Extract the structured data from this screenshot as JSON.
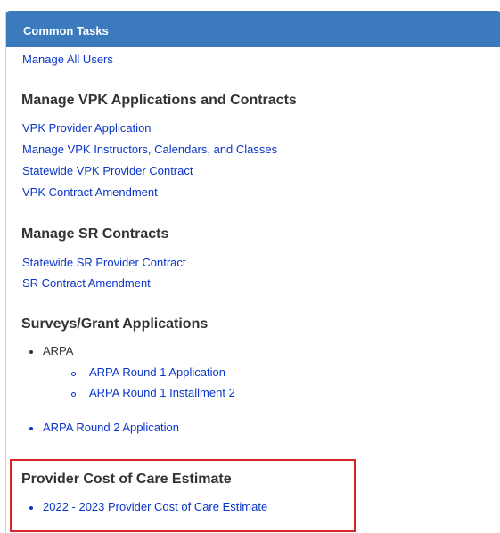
{
  "panel": {
    "title": "Common Tasks"
  },
  "top_link": "Manage All Users",
  "sections": {
    "vpk": {
      "heading": "Manage VPK Applications and Contracts",
      "links": [
        "VPK Provider Application",
        "Manage VPK Instructors, Calendars, and Classes",
        "Statewide VPK Provider Contract",
        "VPK Contract Amendment"
      ]
    },
    "sr": {
      "heading": "Manage SR Contracts",
      "links": [
        "Statewide SR Provider Contract",
        "SR Contract Amendment"
      ]
    },
    "surveys": {
      "heading": "Surveys/Grant Applications",
      "group_label": "ARPA",
      "sub_links": [
        "ARPA Round 1 Application",
        "ARPA Round 1 Installment 2"
      ],
      "link": "ARPA Round 2 Application"
    },
    "cost_of_care": {
      "heading": "Provider Cost of Care Estimate",
      "link": "2022 - 2023 Provider Cost of Care Estimate"
    }
  },
  "colors": {
    "header_bg": "#3b7bbd",
    "link": "#0a35c8",
    "heading": "#333333",
    "highlight_border": "#d9242b"
  }
}
